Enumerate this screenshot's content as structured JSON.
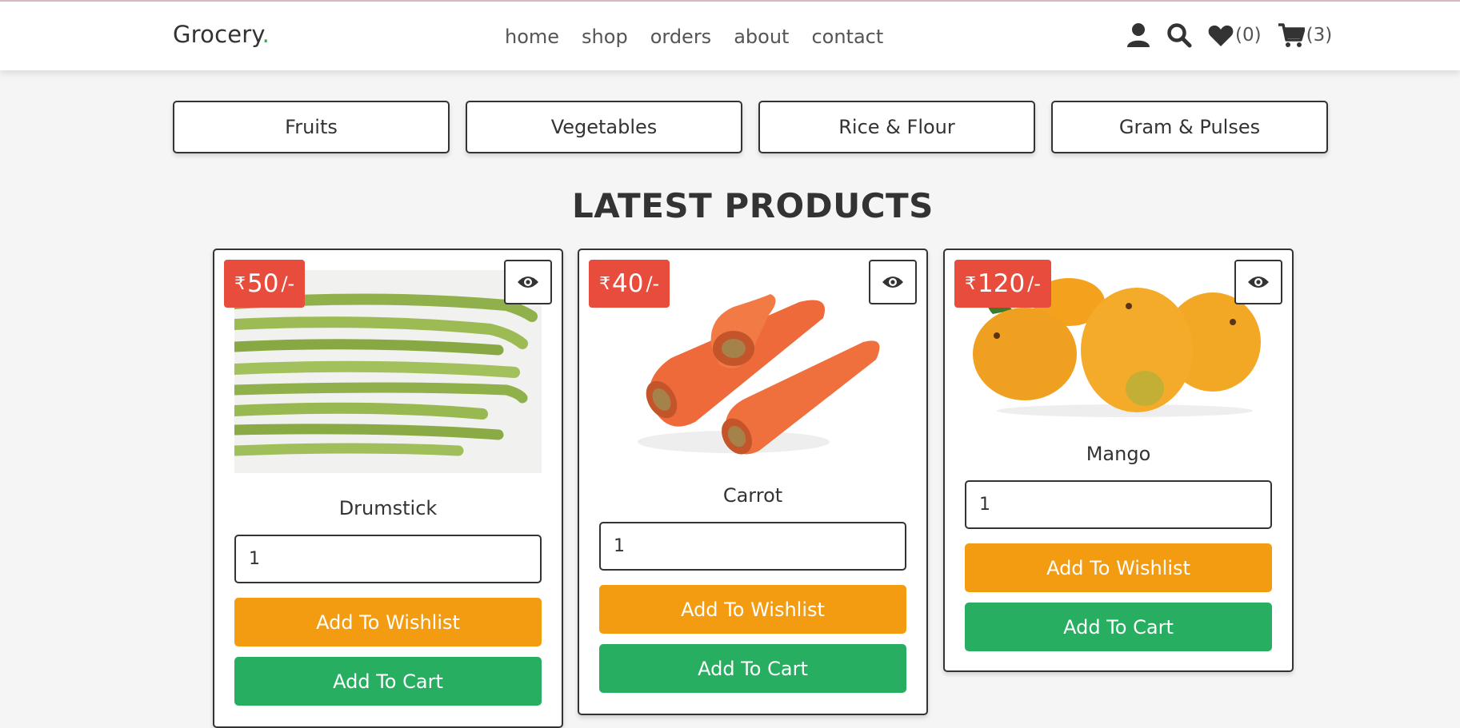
{
  "logo": {
    "text": "Grocery",
    "dot": "."
  },
  "nav": [
    "home",
    "shop",
    "orders",
    "about",
    "contact"
  ],
  "header_icons": {
    "user": "user-icon",
    "search": "search-icon",
    "wishlist": {
      "icon": "heart-icon",
      "count": "(0)"
    },
    "cart": {
      "icon": "cart-icon",
      "count": "(3)"
    }
  },
  "categories": [
    "Fruits",
    "Vegetables",
    "Rice & Flour",
    "Gram & Pulses"
  ],
  "section_title": "LATEST PRODUCTS",
  "products": [
    {
      "price": "50",
      "name": "Drumstick",
      "qty": "1",
      "wishlist_label": "Add To Wishlist",
      "cart_label": "Add To Cart"
    },
    {
      "price": "40",
      "name": "Carrot",
      "qty": "1",
      "wishlist_label": "Add To Wishlist",
      "cart_label": "Add To Cart"
    },
    {
      "price": "120",
      "name": "Mango",
      "qty": "1",
      "wishlist_label": "Add To Wishlist",
      "cart_label": "Add To Cart"
    }
  ],
  "price_prefix": "₹",
  "price_suffix": "/-",
  "colors": {
    "accent": "#27ae60",
    "price_badge": "#e74c3c",
    "wishlist": "#f39c12",
    "cart": "#27ae60"
  }
}
